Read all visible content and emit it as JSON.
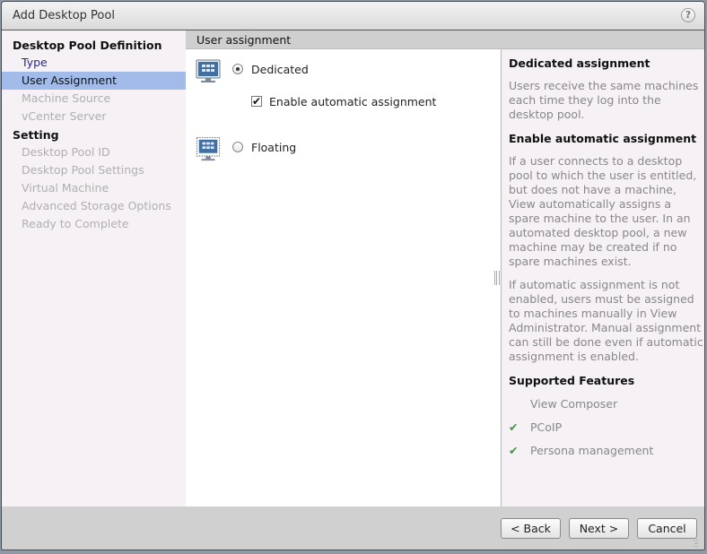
{
  "window": {
    "title": "Add Desktop Pool",
    "help_icon": "?"
  },
  "nav": {
    "sections": [
      {
        "heading": "Desktop Pool Definition",
        "items": [
          {
            "label": "Type",
            "state": "done"
          },
          {
            "label": "User Assignment",
            "state": "active"
          },
          {
            "label": "Machine Source",
            "state": "disabled"
          },
          {
            "label": "vCenter Server",
            "state": "disabled"
          }
        ]
      },
      {
        "heading": "Setting",
        "items": [
          {
            "label": "Desktop Pool ID",
            "state": "disabled"
          },
          {
            "label": "Desktop Pool Settings",
            "state": "disabled"
          },
          {
            "label": "Virtual Machine",
            "state": "disabled"
          },
          {
            "label": "Advanced Storage Options",
            "state": "disabled"
          },
          {
            "label": "Ready to Complete",
            "state": "disabled"
          }
        ]
      }
    ]
  },
  "main": {
    "section_title": "User assignment",
    "options": [
      {
        "label": "Dedicated",
        "selected": true,
        "icon": "monitor-icon"
      },
      {
        "label": "Floating",
        "selected": false,
        "icon": "monitor-dashed-icon"
      }
    ],
    "auto_assign": {
      "label": "Enable automatic assignment",
      "checked": true,
      "mark": "✔"
    }
  },
  "help": {
    "h1": "Dedicated assignment",
    "p1": "Users receive the same machines each time they log into the desktop pool.",
    "h2": "Enable automatic assignment",
    "p2": "If a user connects to a desktop pool to which the user is entitled, but does not have a machine, View automatically assigns a spare machine to the user. In an automated desktop pool, a new machine may be created if no spare machines exist.",
    "p3": "If automatic assignment is not enabled, users must be assigned to machines manually in View Administrator. Manual assignment can still be done even if automatic assignment is enabled.",
    "h3": "Supported Features",
    "features": [
      {
        "label": "View Composer",
        "supported": false,
        "mark": ""
      },
      {
        "label": "PCoIP",
        "supported": true,
        "mark": "✔"
      },
      {
        "label": "Persona management",
        "supported": true,
        "mark": "✔"
      }
    ]
  },
  "footer": {
    "back": "< Back",
    "next": "Next >",
    "cancel": "Cancel"
  },
  "colors": {
    "active_nav": "#a2bbe8",
    "check_green": "#3c9a3c",
    "done_link": "#2a2a8a"
  }
}
